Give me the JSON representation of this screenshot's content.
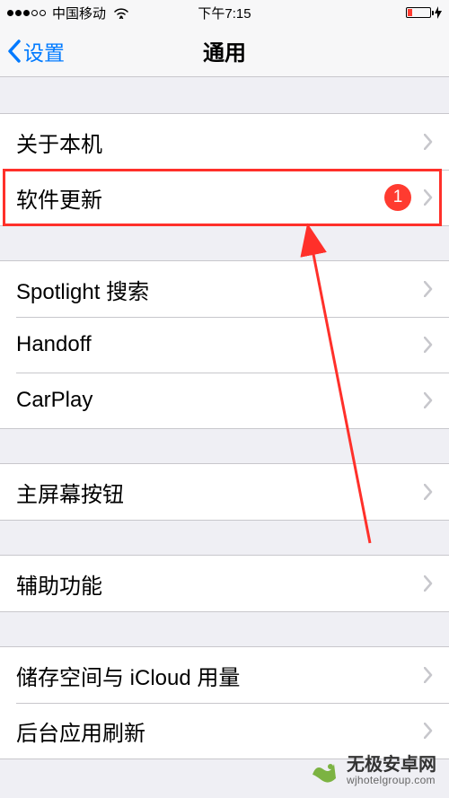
{
  "status": {
    "carrier": "中国移动",
    "time": "下午7:15"
  },
  "nav": {
    "back": "设置",
    "title": "通用"
  },
  "groups": {
    "g1": {
      "about": "关于本机",
      "software_update": "软件更新",
      "software_update_badge": "1"
    },
    "g2": {
      "spotlight": "Spotlight 搜索",
      "handoff": "Handoff",
      "carplay": "CarPlay"
    },
    "g3": {
      "home_button": "主屏幕按钮"
    },
    "g4": {
      "accessibility": "辅助功能"
    },
    "g5": {
      "storage": "储存空间与 iCloud 用量",
      "background_refresh": "后台应用刷新"
    }
  },
  "watermark": {
    "title": "无极安卓网",
    "url": "wjhotelgroup.com"
  }
}
